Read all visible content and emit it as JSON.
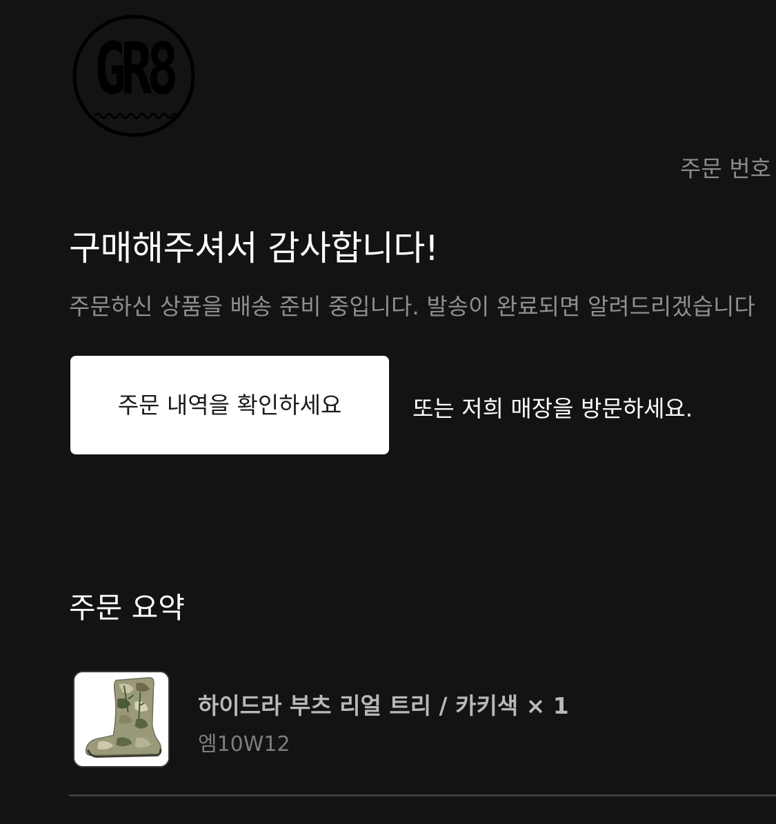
{
  "header": {
    "logo_text": "GR8",
    "order_number_label": "주문 번호"
  },
  "confirmation": {
    "title": "구매해주셔서 감사합니다!",
    "message": "주문하신 상품을 배송 준비 중입니다. 발송이 완료되면 알려드리겠습니다"
  },
  "actions": {
    "view_order_button": "주문 내역을 확인하세요",
    "visit_store_text": "또는 저희 매장을 방문하세요."
  },
  "summary": {
    "heading": "주문 요약",
    "items": [
      {
        "name": "하이드라 부츠 리얼 트리 / 카키색 × 1",
        "variant": "엠10W12",
        "image_icon": "camo-boot-image"
      }
    ]
  },
  "colors": {
    "background": "#131313",
    "text_primary": "#ffffff",
    "text_secondary": "#8f8f8f",
    "button_background": "#ffffff",
    "button_text": "#1a1a1a",
    "divider": "#3d3d3d"
  }
}
